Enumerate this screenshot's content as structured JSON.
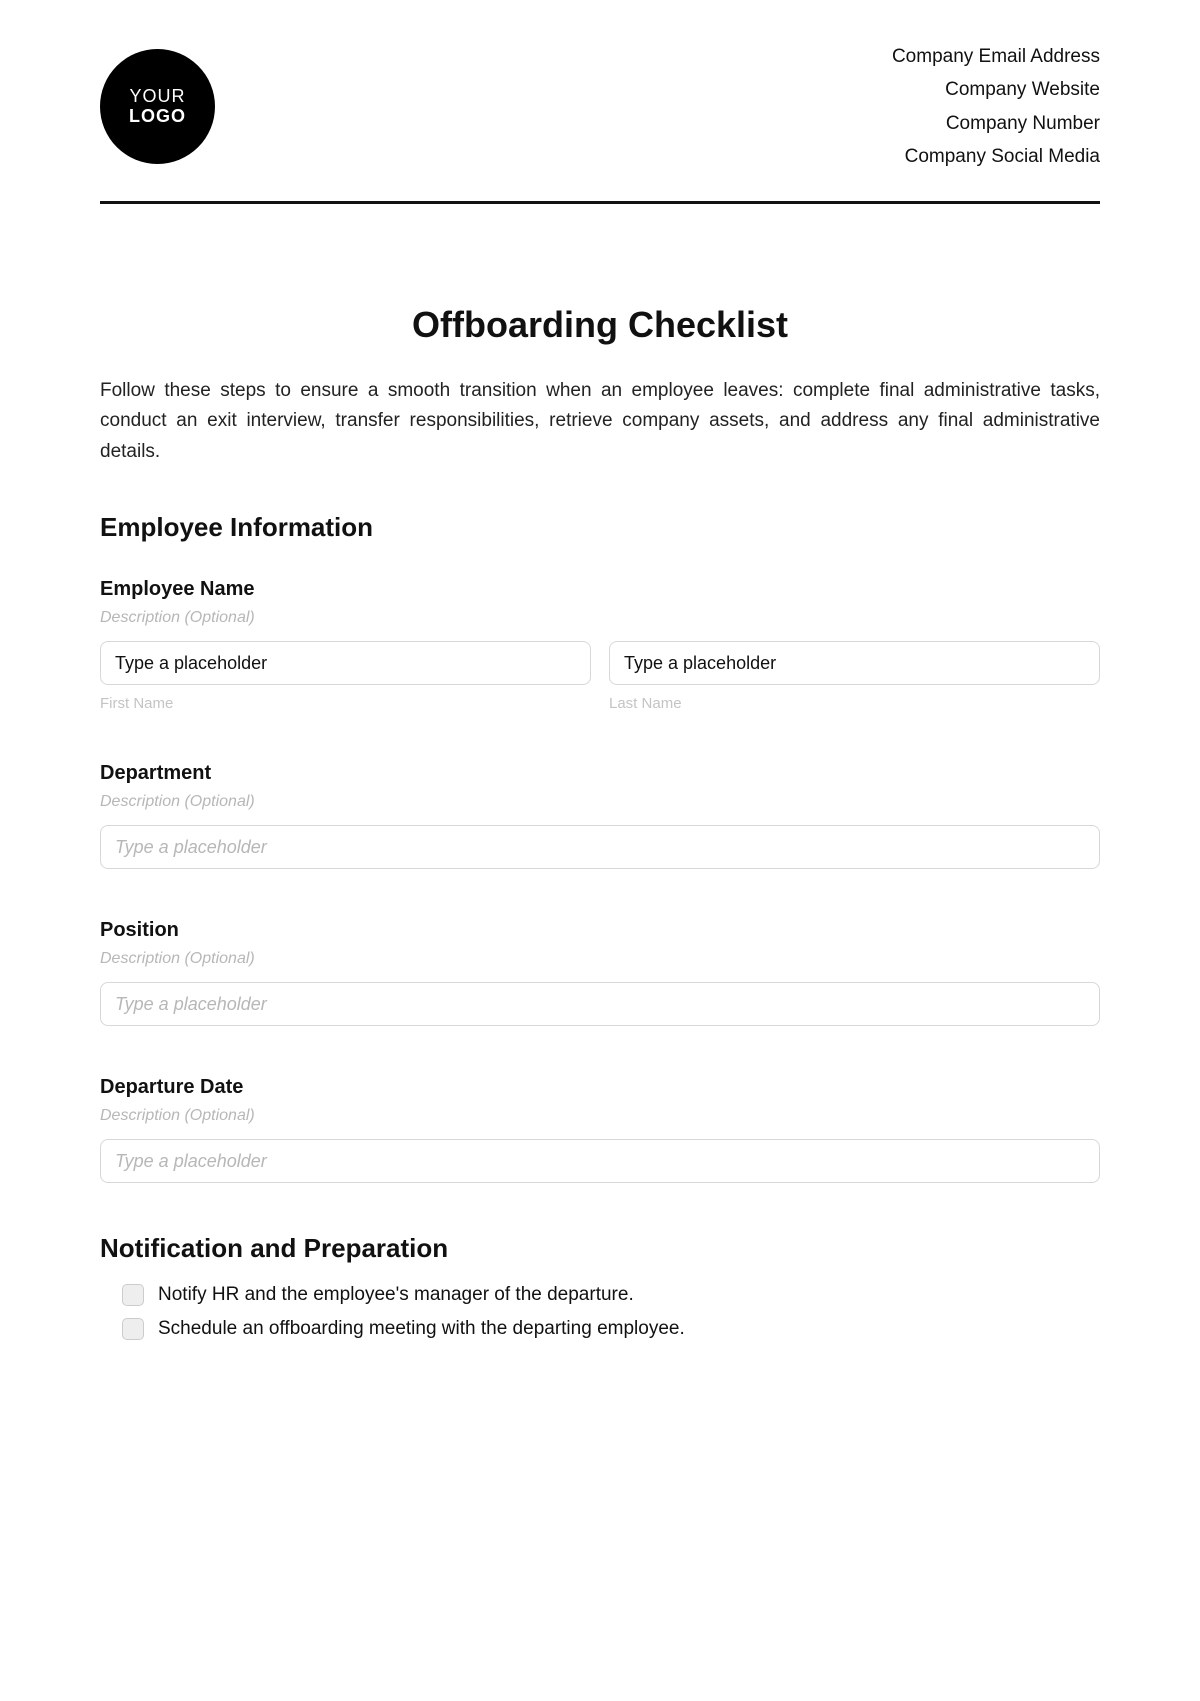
{
  "header": {
    "logo_line1": "YOUR",
    "logo_line2": "LOGO",
    "company_lines": [
      "Company Email Address",
      "Company Website",
      "Company Number",
      "Company Social Media"
    ]
  },
  "title": "Offboarding Checklist",
  "intro": "Follow these steps to ensure a smooth transition when an employee leaves: complete final administrative tasks, conduct an exit interview, transfer responsibilities, retrieve company assets, and address any final administrative details.",
  "section1_heading": "Employee Information",
  "employee_name": {
    "label": "Employee Name",
    "desc": "Description (Optional)",
    "first_placeholder": "Type a placeholder",
    "last_placeholder": "Type a placeholder",
    "first_sub": "First Name",
    "last_sub": "Last Name"
  },
  "department": {
    "label": "Department",
    "desc": "Description (Optional)",
    "placeholder": "Type a placeholder"
  },
  "position": {
    "label": "Position",
    "desc": "Description (Optional)",
    "placeholder": "Type a placeholder"
  },
  "departure": {
    "label": "Departure Date",
    "desc": "Description (Optional)",
    "placeholder": "Type a placeholder"
  },
  "section2_heading": "Notification and Preparation",
  "checklist": [
    "Notify HR and the employee's manager of the departure.",
    "Schedule an offboarding meeting with the departing employee."
  ]
}
